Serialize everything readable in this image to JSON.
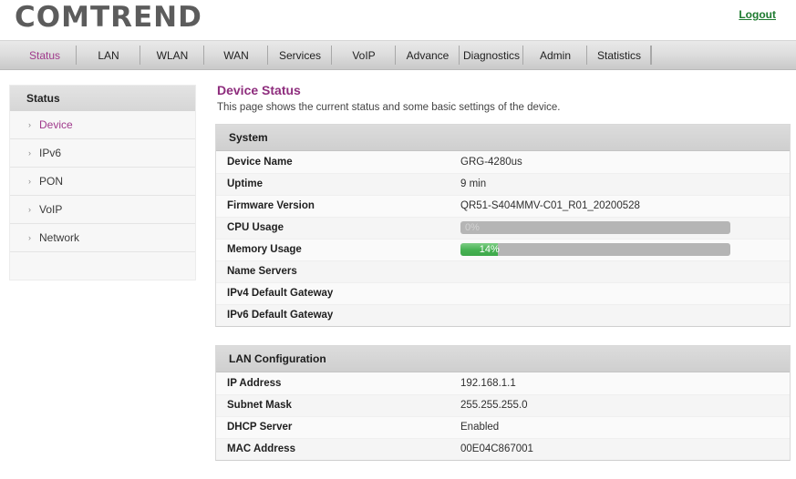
{
  "header": {
    "logo_text": "COMTREND",
    "logout_label": "Logout"
  },
  "navbar": {
    "tabs": [
      {
        "label": "Status",
        "active": true
      },
      {
        "label": "LAN",
        "active": false
      },
      {
        "label": "WLAN",
        "active": false
      },
      {
        "label": "WAN",
        "active": false
      },
      {
        "label": "Services",
        "active": false
      },
      {
        "label": "VoIP",
        "active": false
      },
      {
        "label": "Advance",
        "active": false
      },
      {
        "label": "Diagnostics",
        "active": false
      },
      {
        "label": "Admin",
        "active": false
      },
      {
        "label": "Statistics",
        "active": false
      }
    ]
  },
  "sidebar": {
    "header": "Status",
    "items": [
      {
        "label": "Device",
        "arrow": "›",
        "active": true
      },
      {
        "label": "IPv6",
        "arrow": "›",
        "active": false
      },
      {
        "label": "PON",
        "arrow": "›",
        "active": false
      },
      {
        "label": "VoIP",
        "arrow": "›",
        "active": false
      },
      {
        "label": "Network",
        "arrow": "›",
        "active": false
      }
    ]
  },
  "main": {
    "title": "Device Status",
    "description": "This page shows the current status and some basic settings of the device.",
    "system": {
      "header": "System",
      "rows": [
        {
          "label": "Device Name",
          "value": "GRG-4280us"
        },
        {
          "label": "Uptime",
          "value": "9 min"
        },
        {
          "label": "Firmware Version",
          "value": "QR51-S404MMV-C01_R01_20200528"
        },
        {
          "label": "CPU Usage",
          "value": "",
          "bar": {
            "percent": 0,
            "text": "0%",
            "dim": true
          }
        },
        {
          "label": "Memory Usage",
          "value": "",
          "bar": {
            "percent": 14,
            "text": "14%",
            "dim": false
          }
        },
        {
          "label": "Name Servers",
          "value": ""
        },
        {
          "label": "IPv4 Default Gateway",
          "value": ""
        },
        {
          "label": "IPv6 Default Gateway",
          "value": ""
        }
      ]
    },
    "lan": {
      "header": "LAN Configuration",
      "rows": [
        {
          "label": "IP Address",
          "value": "192.168.1.1"
        },
        {
          "label": "Subnet Mask",
          "value": "255.255.255.0"
        },
        {
          "label": "DHCP Server",
          "value": "Enabled"
        },
        {
          "label": "MAC Address",
          "value": "00E04C867001"
        }
      ]
    }
  },
  "colors": {
    "accent_purple": "#a03a8c",
    "logout_green": "#1d7a2f",
    "bar_green": "#46b152",
    "bar_track_gray": "#b5b5b5"
  }
}
